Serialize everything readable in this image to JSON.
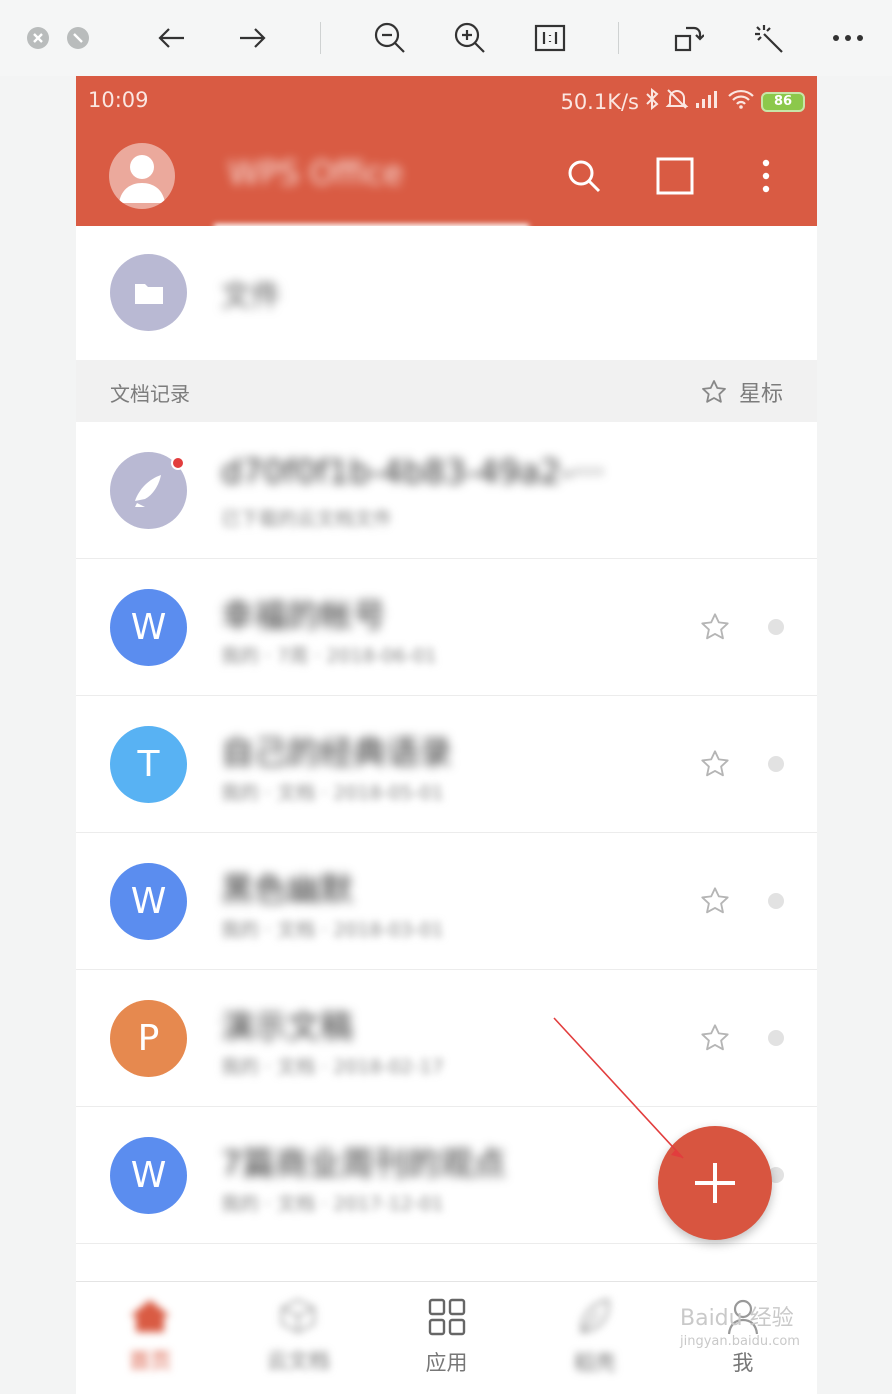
{
  "viewer_toolbar": {
    "buttons": [
      "close-icon",
      "minimize-icon",
      "back-arrow-icon",
      "forward-arrow-icon",
      "zoom-out-icon",
      "zoom-in-icon",
      "actual-size-icon",
      "rotate-icon",
      "magic-wand-icon",
      "more-icon"
    ]
  },
  "status_bar": {
    "time": "10:09",
    "network_speed": "50.1K/s",
    "battery": "86"
  },
  "app_bar": {
    "title": "WPS Office"
  },
  "folder_row": {
    "label": "文件"
  },
  "section": {
    "left_label": "文档记录",
    "right_label": "星标"
  },
  "rows": [
    {
      "icon_letter": "",
      "icon_color": "#b9b9d3",
      "title": "d70f0f1b-4b83-49a2-···",
      "subtitle": "已下载的云文档文件",
      "starrable": false,
      "badge": true
    },
    {
      "icon_letter": "W",
      "icon_color": "#5b8def",
      "title": "幸福的帐号",
      "subtitle": "我的 · 7周 · 2018-06-01",
      "starrable": true,
      "badge": false
    },
    {
      "icon_letter": "T",
      "icon_color": "#58b2f3",
      "title": "自己的经典语录",
      "subtitle": "我的 · 文档 · 2018-05-01",
      "starrable": true,
      "badge": false
    },
    {
      "icon_letter": "W",
      "icon_color": "#5b8def",
      "title": "黑色幽默",
      "subtitle": "我的 · 文档 · 2018-03-01",
      "starrable": true,
      "badge": false
    },
    {
      "icon_letter": "P",
      "icon_color": "#e6894f",
      "title": "演示文稿",
      "subtitle": "我的 · 文档 · 2018-02-17",
      "starrable": true,
      "badge": false
    },
    {
      "icon_letter": "W",
      "icon_color": "#5b8def",
      "title": "7篇商业周刊的观点",
      "subtitle": "我的 · 文档 · 2017-12-01",
      "starrable": true,
      "badge": false
    }
  ],
  "bottom_nav": [
    {
      "label": "首页",
      "icon": "home-icon",
      "active": true
    },
    {
      "label": "云文档",
      "icon": "cube-icon",
      "active": false
    },
    {
      "label": "应用",
      "icon": "grid-icon",
      "active": false
    },
    {
      "label": "稻壳",
      "icon": "leaf-icon",
      "active": false
    },
    {
      "label": "我",
      "icon": "person-icon",
      "active": false
    }
  ],
  "colors": {
    "brand": "#d95b43",
    "fab": "#d85540"
  },
  "watermark": {
    "text": "Baidu 经验",
    "url": "jingyan.baidu.com"
  }
}
